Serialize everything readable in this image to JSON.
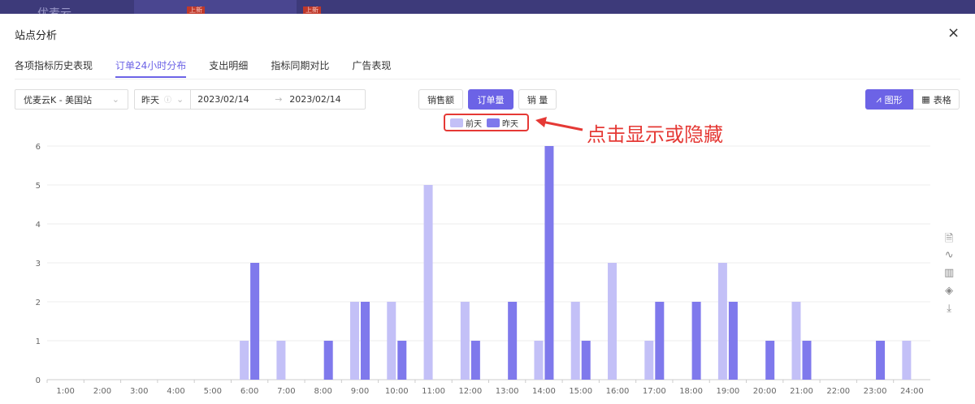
{
  "topbar": {
    "logo": "优麦云",
    "badges": [
      "上新",
      "上新"
    ]
  },
  "dialog": {
    "title": "站点分析",
    "close": "×"
  },
  "tabs": [
    {
      "label": "各项指标历史表现"
    },
    {
      "label": "订单24小时分布",
      "active": true
    },
    {
      "label": "支出明细"
    },
    {
      "label": "指标同期对比"
    },
    {
      "label": "广告表现"
    }
  ],
  "filters": {
    "shop": "优麦云K - 美国站",
    "period": "昨天",
    "start_date": "2023/02/14",
    "arrow": "→",
    "end_date": "2023/02/14"
  },
  "metrics": {
    "sales": "销售额",
    "orders": "订单量",
    "quantity": "销 量"
  },
  "view": {
    "chart": "图形",
    "table": "表格"
  },
  "annotation": "点击显示或隐藏",
  "colors": {
    "accent": "#6c63e6",
    "series_prev": "#c3c0f7",
    "series_yest": "#7f79ec"
  },
  "chart_data": {
    "type": "bar",
    "categories": [
      "1:00",
      "2:00",
      "3:00",
      "4:00",
      "5:00",
      "6:00",
      "7:00",
      "8:00",
      "9:00",
      "10:00",
      "11:00",
      "12:00",
      "13:00",
      "14:00",
      "15:00",
      "16:00",
      "17:00",
      "18:00",
      "19:00",
      "20:00",
      "21:00",
      "22:00",
      "23:00",
      "24:00"
    ],
    "series": [
      {
        "name": "前天",
        "values": [
          0,
          0,
          0,
          0,
          0,
          1,
          1,
          0,
          2,
          2,
          5,
          2,
          0,
          1,
          2,
          3,
          1,
          0,
          3,
          0,
          2,
          0,
          0,
          1
        ]
      },
      {
        "name": "昨天",
        "values": [
          0,
          0,
          0,
          0,
          0,
          3,
          0,
          1,
          2,
          1,
          0,
          1,
          2,
          6,
          1,
          0,
          2,
          2,
          2,
          1,
          1,
          0,
          1,
          0
        ]
      }
    ],
    "yticks": [
      0,
      1,
      2,
      3,
      4,
      5,
      6
    ],
    "ylim": [
      0,
      6
    ],
    "legend": "top-center"
  }
}
